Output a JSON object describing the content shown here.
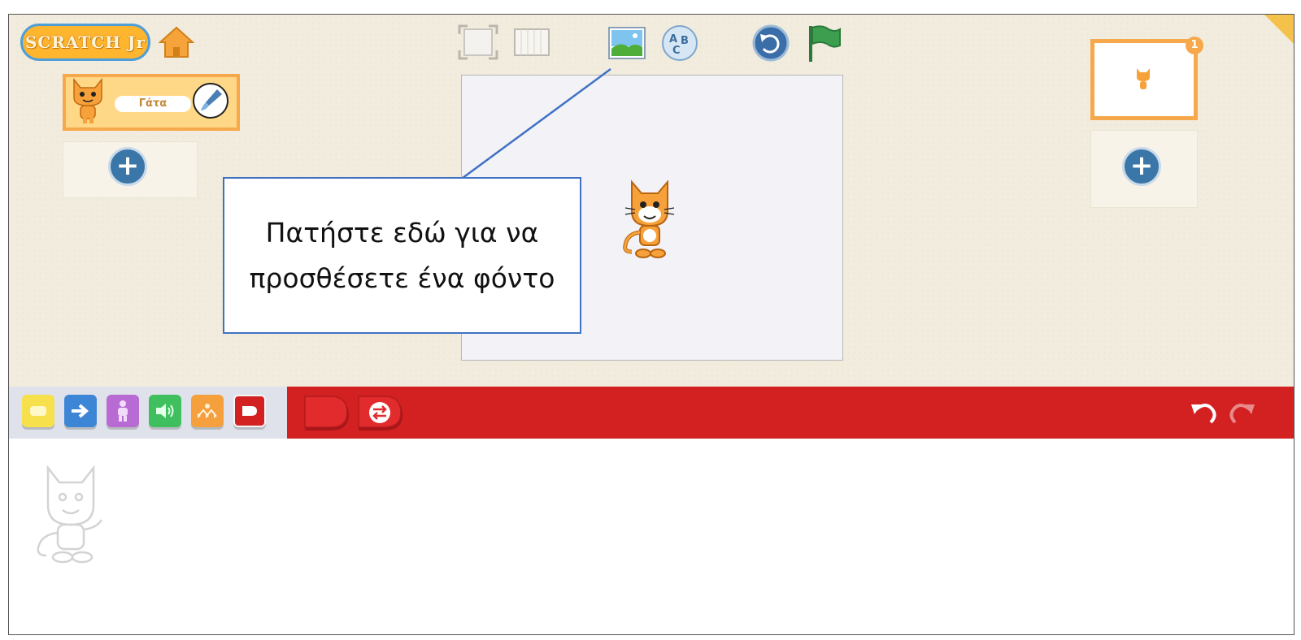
{
  "app": {
    "logo_text": "SCRATCH Jr"
  },
  "sprite": {
    "name": "Γάτα"
  },
  "callout": {
    "text": "Πατήστε εδώ για να προσθέσετε ένα φόντο"
  },
  "pages": {
    "current_number": "1"
  },
  "toolbar": {
    "icons": [
      "home-icon",
      "fullscreen-icon",
      "grid-icon",
      "background-image-icon",
      "text-abc-icon",
      "reset-icon",
      "green-flag-icon"
    ]
  },
  "block_categories": [
    {
      "name": "triggering",
      "color": "#f6e04c"
    },
    {
      "name": "motion",
      "color": "#3d86d6"
    },
    {
      "name": "looks",
      "color": "#b86bd3"
    },
    {
      "name": "sound",
      "color": "#3fbf5e"
    },
    {
      "name": "control",
      "color": "#f5a03c"
    },
    {
      "name": "end",
      "color": "#d32122"
    }
  ],
  "end_blocks": [
    "end-block",
    "repeat-forever-block"
  ],
  "colors": {
    "accent_red": "#d32122",
    "callout_border": "#3f72c4",
    "sprite_orange": "#f7a84a"
  }
}
